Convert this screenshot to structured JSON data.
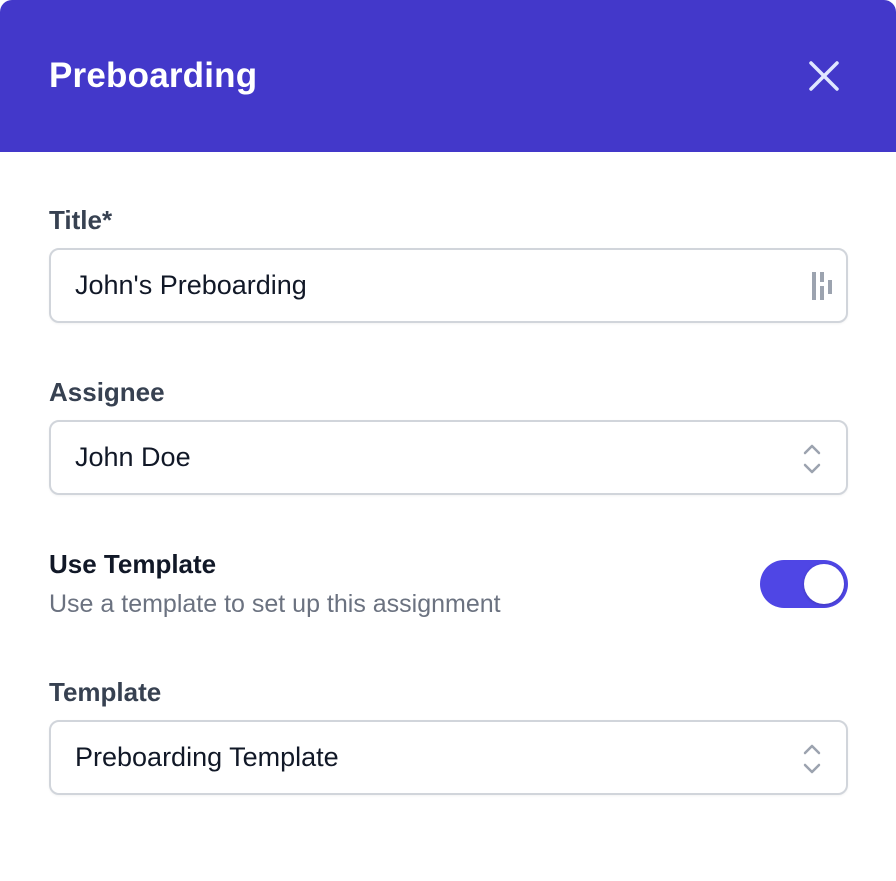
{
  "dialog": {
    "title": "Preboarding",
    "close_icon": "close-icon"
  },
  "fields": {
    "title": {
      "label": "Title*",
      "value": "John's Preboarding",
      "icon": "password-manager-icon"
    },
    "assignee": {
      "label": "Assignee",
      "value": "John Doe",
      "icon": "chevron-up-down-icon"
    },
    "use_template": {
      "label": "Use Template",
      "description": "Use a template to set up this assignment",
      "enabled": true
    },
    "template": {
      "label": "Template",
      "value": "Preboarding Template",
      "icon": "chevron-up-down-icon"
    }
  },
  "colors": {
    "header": "#4338ca",
    "toggle_on": "#4f46e5",
    "label": "#374151",
    "muted": "#6b7280",
    "border": "#d1d5db"
  }
}
